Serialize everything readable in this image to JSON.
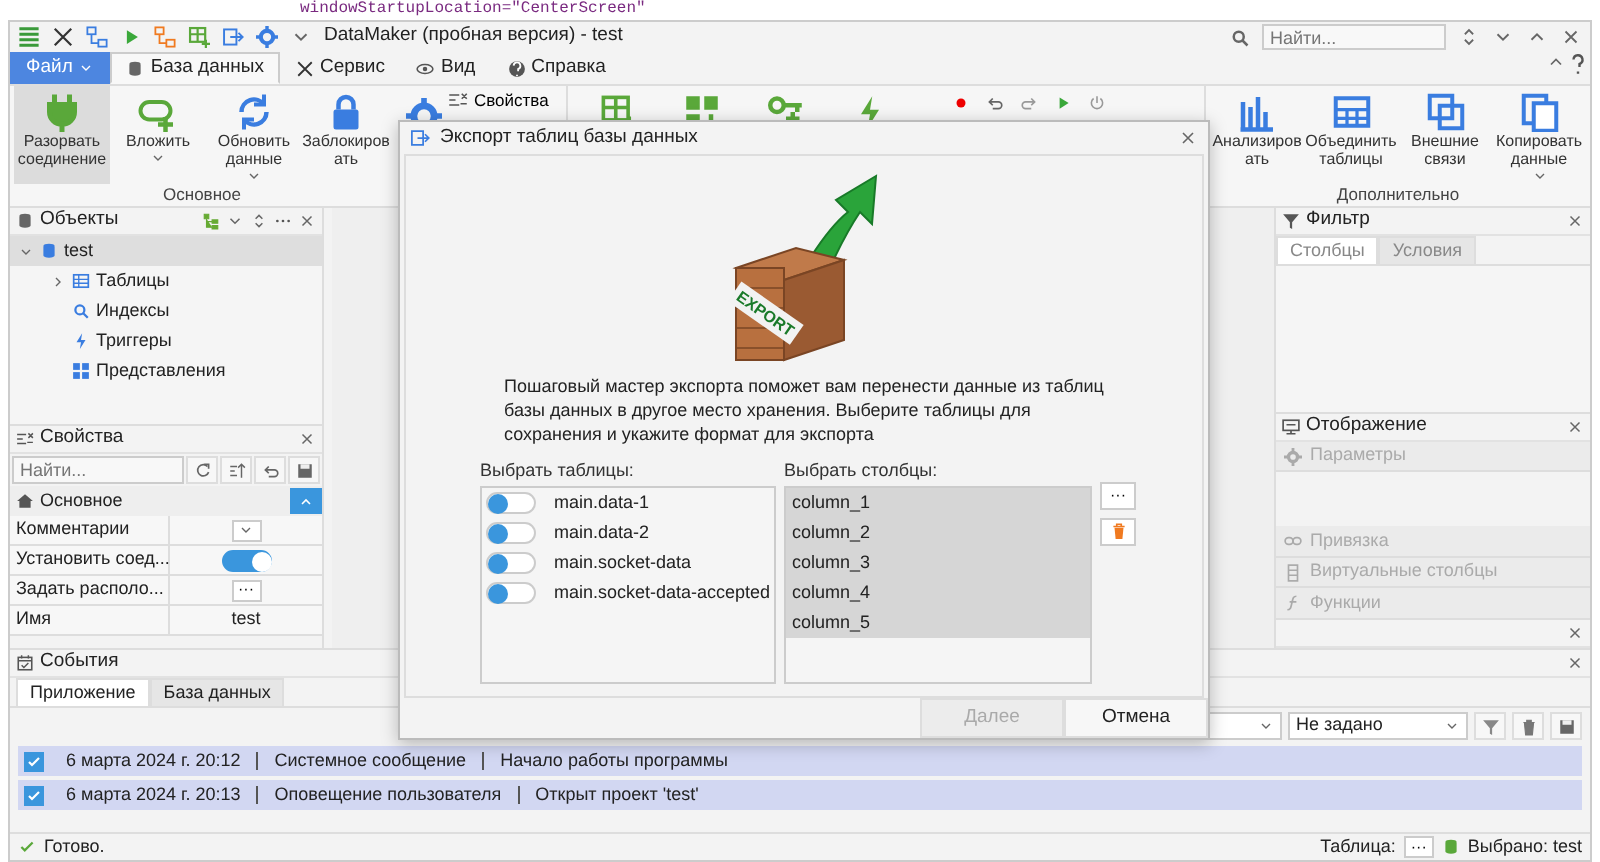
{
  "background_code": "windowStartupLocation=\"CenterScreen\"",
  "window": {
    "title": "DataMaker (пробная версия) - test",
    "search_placeholder": "Найти..."
  },
  "ribbon_tabs": [
    {
      "label": "Файл",
      "kind": "menu",
      "selected": false
    },
    {
      "label": "База данных",
      "kind": "tab",
      "selected": true
    },
    {
      "label": "Сервис",
      "kind": "tab",
      "selected": false
    },
    {
      "label": "Вид",
      "kind": "tab",
      "selected": false
    },
    {
      "label": "Справка",
      "kind": "tab",
      "selected": false
    }
  ],
  "ribbon_groups": [
    {
      "label": "Основное",
      "buttons": [
        {
          "label": "Разорвать соединение",
          "pressed": true,
          "dropdown": false
        },
        {
          "label": "Вложить",
          "pressed": false,
          "dropdown": true
        },
        {
          "label": "Обновить данные",
          "pressed": false,
          "dropdown": true
        },
        {
          "label": "Заблокировать",
          "pressed": false,
          "dropdown": false
        }
      ],
      "small_buttons": [
        "Свойства"
      ]
    },
    {
      "label": "Дополнительно",
      "buttons": [
        {
          "label": "Анализировать",
          "pressed": false,
          "dropdown": false
        },
        {
          "label": "Объединить таблицы",
          "pressed": false,
          "dropdown": false
        },
        {
          "label": "Внешние связи",
          "pressed": false,
          "dropdown": false
        },
        {
          "label": "Копировать данные",
          "pressed": false,
          "dropdown": true
        }
      ]
    }
  ],
  "objects_panel": {
    "title": "Объекты",
    "tree": [
      {
        "label": "test",
        "selected": true,
        "expanded": true,
        "children": [
          {
            "label": "Таблицы",
            "selected": false,
            "expanded": false
          },
          {
            "label": "Индексы",
            "selected": false
          },
          {
            "label": "Триггеры",
            "selected": false
          },
          {
            "label": "Представления",
            "selected": false
          }
        ]
      }
    ]
  },
  "properties_panel": {
    "title": "Свойства",
    "search_placeholder": "Найти...",
    "category": "Основное",
    "rows": [
      {
        "name": "Комментарии",
        "kind": "dropdown"
      },
      {
        "name": "Установить соед...",
        "kind": "toggle",
        "on": true
      },
      {
        "name": "Задать располо...",
        "kind": "ellipsis",
        "value": "···"
      },
      {
        "name": "Имя",
        "kind": "text",
        "value": "test"
      }
    ]
  },
  "filter_panel": {
    "title": "Фильтр",
    "tabs": [
      {
        "label": "Столбцы",
        "selected": true
      },
      {
        "label": "Условия",
        "selected": false
      }
    ]
  },
  "display_panel": {
    "title": "Отображение",
    "sections": [
      {
        "label": "Параметры",
        "disabled": true
      },
      {
        "label": "Привязка",
        "disabled": true
      },
      {
        "label": "Виртуальные столбцы",
        "disabled": true
      },
      {
        "label": "Функции",
        "disabled": true
      }
    ]
  },
  "events_panel": {
    "title": "События",
    "tabs": [
      {
        "label": "Приложение",
        "selected": true
      },
      {
        "label": "База данных",
        "selected": false
      }
    ],
    "filter_value": "Не задано",
    "rows": [
      {
        "checked": true,
        "time": "6 марта 2024 г. 20:12",
        "type": "Системное сообщение",
        "message": "Начало работы программы"
      },
      {
        "checked": true,
        "time": "6 марта 2024 г. 20:13",
        "type": "Оповещение пользователя",
        "message": "Открыт проект 'test'"
      }
    ]
  },
  "status_bar": {
    "status": "Готово.",
    "table_label": "Таблица:",
    "table_button": "···",
    "selected": "Выбрано: test"
  },
  "dialog": {
    "title": "Экспорт таблиц базы данных",
    "image_label": "EXPORT",
    "description": "Пошаговый мастер экспорта поможет вам перенести данные из таблиц базы данных в другое место хранения. Выберите таблицы для сохранения и укажите формат для экспорта",
    "tables_label": "Выбрать таблицы:",
    "tables": [
      {
        "name": "main.data-1",
        "on": false
      },
      {
        "name": "main.data-2",
        "on": false
      },
      {
        "name": "main.socket-data",
        "on": false
      },
      {
        "name": "main.socket-data-accepted",
        "on": false
      }
    ],
    "columns_label": "Выбрать столбцы:",
    "columns": [
      {
        "name": "column_1",
        "selected": true
      },
      {
        "name": "column_2",
        "selected": true
      },
      {
        "name": "column_3",
        "selected": true
      },
      {
        "name": "column_4",
        "selected": true
      },
      {
        "name": "column_5",
        "selected": true
      }
    ],
    "columns_more_button": "···",
    "buttons": [
      {
        "label": "Далее",
        "disabled": true
      },
      {
        "label": "Отмена",
        "disabled": false
      }
    ]
  }
}
